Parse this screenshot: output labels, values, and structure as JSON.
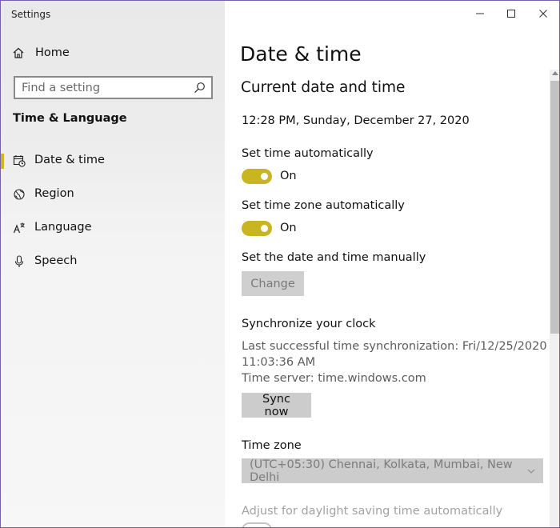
{
  "window": {
    "title": "Settings"
  },
  "sidebar": {
    "home_label": "Home",
    "search_placeholder": "Find a setting",
    "section_title": "Time & Language",
    "items": [
      {
        "label": "Date & time",
        "icon": "calendar-clock-icon",
        "active": true
      },
      {
        "label": "Region",
        "icon": "globe-icon",
        "active": false
      },
      {
        "label": "Language",
        "icon": "language-icon",
        "active": false
      },
      {
        "label": "Speech",
        "icon": "microphone-icon",
        "active": false
      }
    ]
  },
  "main": {
    "page_title": "Date & time",
    "current_heading": "Current date and time",
    "current_datetime": "12:28 PM, Sunday, December 27, 2020",
    "set_time_auto": {
      "label": "Set time automatically",
      "state": "On",
      "on": true
    },
    "set_zone_auto": {
      "label": "Set time zone automatically",
      "state": "On",
      "on": true
    },
    "manual": {
      "label": "Set the date and time manually",
      "button": "Change",
      "enabled": false
    },
    "sync": {
      "heading": "Synchronize your clock",
      "last_sync_line1": "Last successful time synchronization: Fri/12/25/2020",
      "last_sync_line2": "11:03:36 AM",
      "server": "Time server: time.windows.com",
      "button": "Sync now"
    },
    "timezone": {
      "label": "Time zone",
      "selected": "(UTC+05:30) Chennai, Kolkata, Mumbai, New Delhi",
      "enabled": false
    },
    "daylight_label": "Adjust for daylight saving time automatically"
  },
  "colors": {
    "accent": "#c9b51f",
    "indicator": "#cdb524",
    "sidebar_bg": "#ececec",
    "window_border": "#7a5fa8"
  }
}
